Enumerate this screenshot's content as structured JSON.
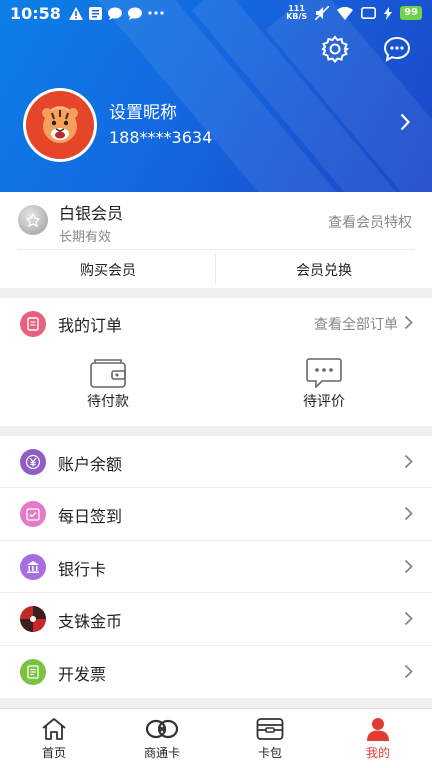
{
  "status_bar": {
    "time": "10:58",
    "net_speed_value": "111",
    "net_speed_unit": "KB/S",
    "battery": "99"
  },
  "profile": {
    "nickname": "设置昵称",
    "phone": "188****3634"
  },
  "member": {
    "level": "白银会员",
    "validity": "长期有效",
    "privilege_link": "查看会员特权",
    "buy_label": "购买会员",
    "redeem_label": "会员兑换"
  },
  "orders": {
    "title": "我的订单",
    "view_all": "查看全部订单",
    "items": [
      {
        "label": "待付款",
        "icon": "wallet-icon"
      },
      {
        "label": "待评价",
        "icon": "comment-icon"
      }
    ]
  },
  "menu": [
    {
      "label": "账户余额",
      "icon": "yuan-icon",
      "color": "#8e5ec4"
    },
    {
      "label": "每日签到",
      "icon": "calendar-check-icon",
      "color": "#e57ac8"
    },
    {
      "label": "银行卡",
      "icon": "bank-icon",
      "color": "#a56fe3"
    },
    {
      "label": "支铢金币",
      "icon": "coin-icon",
      "color": "#c62828"
    },
    {
      "label": "开发票",
      "icon": "invoice-icon",
      "color": "#7cc242"
    }
  ],
  "bottom_nav": [
    {
      "label": "首页",
      "icon": "home-icon"
    },
    {
      "label": "商通卡",
      "icon": "card-link-icon"
    },
    {
      "label": "卡包",
      "icon": "card-wallet-icon"
    },
    {
      "label": "我的",
      "icon": "user-icon",
      "active": true
    }
  ],
  "colors": {
    "header_blue": "#1467e0",
    "active_red": "#e53935",
    "orders_icon": "#e8607f"
  }
}
